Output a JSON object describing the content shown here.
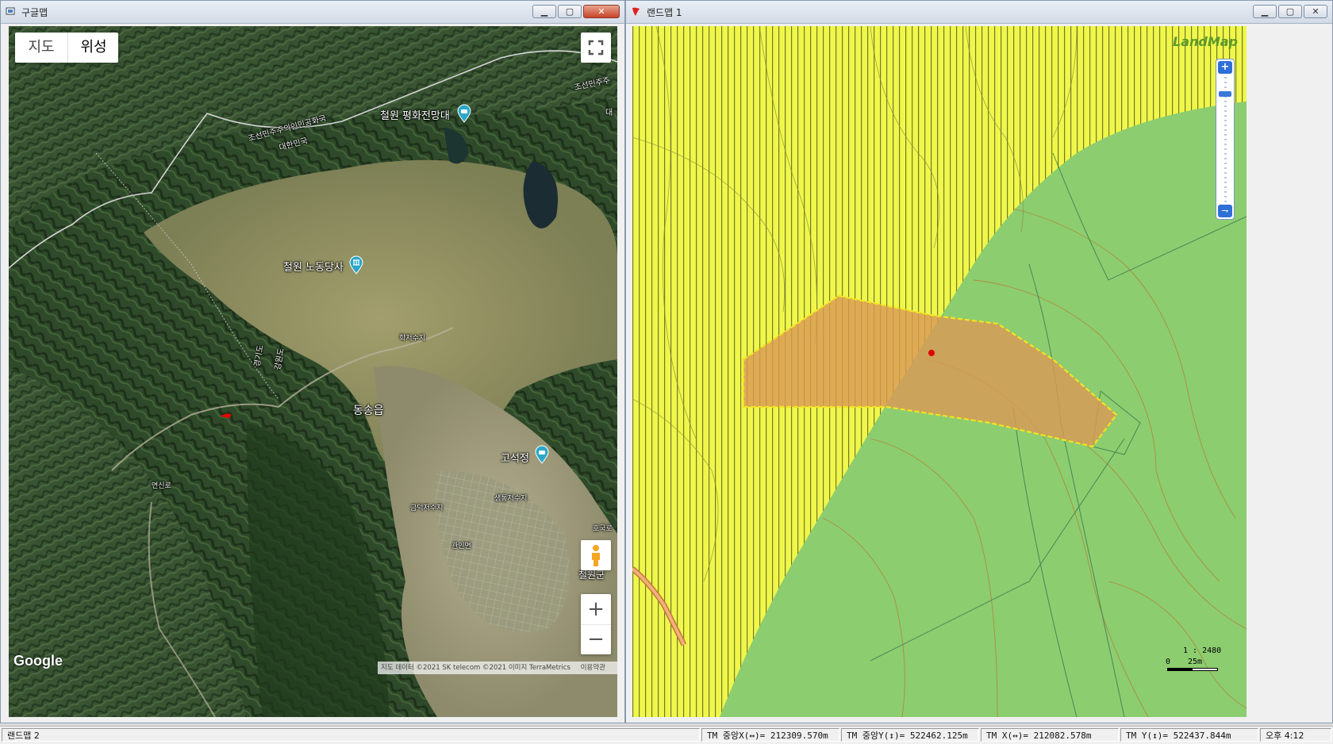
{
  "left_window": {
    "title": "구글맵",
    "map_type": {
      "map_label": "지도",
      "satellite_label": "위성",
      "selected": "위성"
    },
    "places": [
      {
        "name": "철원 평화전망대",
        "icon": "camera-pin-icon"
      },
      {
        "name": "철원 노동당사",
        "icon": "landmark-pin-icon"
      },
      {
        "name": "고석정",
        "icon": "camera-pin-icon"
      }
    ],
    "labels": {
      "town": "동송읍",
      "border_north": "조선민주주의인민공화국",
      "border_south": "대한민국",
      "border_north_right": "조선민주주",
      "border_south_right": "대",
      "province_west": "경기도",
      "province_east": "강원도",
      "lake1": "학저수지",
      "lake2": "금덕저수지",
      "lake3": "샘통저수지",
      "road": "연신로",
      "town2": "관인면",
      "town3": "호국로",
      "county": "철원군"
    },
    "logo": "Google",
    "attribution": "지도 데이터 ©2021 SK telecom ©2021 이미지 TerraMetrics",
    "terms": "이용약관",
    "zoom_in": "+",
    "zoom_out": "−"
  },
  "right_window": {
    "title": "랜드맵 1",
    "logo": "LandMap",
    "scale_text": "1 : 2480",
    "scale_zero": "0",
    "scale_len": "25m",
    "zoom_in": "+",
    "zoom_reset": "⇁"
  },
  "statusbar": {
    "app": "랜드맵 2",
    "tm_center_x": "TM 중앙X(↔)= 212309.570m",
    "tm_center_y": "TM 중앙Y(↕)= 522462.125m",
    "tm_x": "TM X(↔)= 212082.578m",
    "tm_y": "TM Y(↕)= 522437.844m",
    "clock": "오후 4:12"
  },
  "colors": {
    "yellow_zone": "#f0f74a",
    "green_zone": "#8ccd70",
    "parcel_fill": "#d99a55",
    "parcel_border": "#f5e31e",
    "marker": "#e00000",
    "pin_teal": "#2aa7c9"
  }
}
